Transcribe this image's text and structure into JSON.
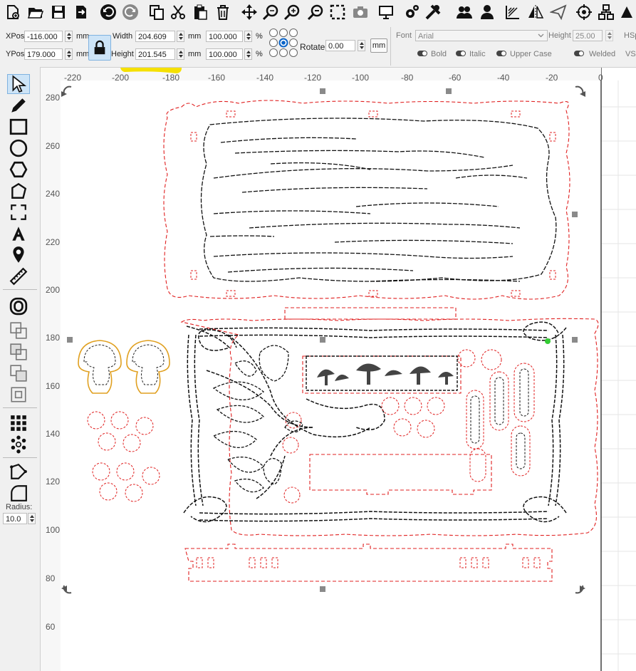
{
  "toolbar": {
    "icons": [
      "new-file-icon",
      "open-folder-icon",
      "save-icon",
      "export-icon",
      "undo-icon",
      "redo-icon",
      "copy-icon",
      "cut-icon",
      "paste-icon",
      "delete-icon",
      "move-icon",
      "zoom-in-icon",
      "zoom-in-plus-icon",
      "zoom-out-icon",
      "zoom-frame-icon",
      "camera-icon",
      "monitor-icon",
      "settings-gear-icon",
      "tools-wrench-icon",
      "users-group-icon",
      "user-icon",
      "align-icon",
      "mirror-icon",
      "send-icon",
      "target-icon",
      "tree-icon"
    ]
  },
  "props": {
    "xpos_label": "XPos",
    "xpos_value": "-116.000",
    "ypos_label": "YPos",
    "ypos_value": "179.000",
    "unit": "mm",
    "width_label": "Width",
    "width_value": "204.609",
    "height_label": "Height",
    "height_value": "201.545",
    "scale_w": "100.000",
    "scale_h": "100.000",
    "percent": "%",
    "rotate_label": "Rotate",
    "rotate_value": "0.00",
    "mm_button": "mm"
  },
  "font": {
    "font_label": "Font",
    "font_value": "Arial",
    "height_label": "Height",
    "height_value": "25.00",
    "hsp_label": "HSp",
    "bold": "Bold",
    "italic": "Italic",
    "upper_case": "Upper Case",
    "welded": "Welded",
    "vsp": "VSp"
  },
  "left_tools": {
    "radius_label": "Radius:",
    "radius_value": "10.0"
  },
  "ruler": {
    "x_labels": [
      "-220",
      "-200",
      "-180",
      "-160",
      "-140",
      "-120",
      "-100",
      "-80",
      "-60",
      "-40",
      "-20",
      "0"
    ],
    "y_labels": [
      "280",
      "260",
      "240",
      "220",
      "200",
      "180",
      "160",
      "140",
      "120",
      "100",
      "80",
      "60"
    ]
  },
  "colors": {
    "accent": "#0a64c8",
    "cut_red": "#e02020",
    "highlight": "#f5e000"
  }
}
